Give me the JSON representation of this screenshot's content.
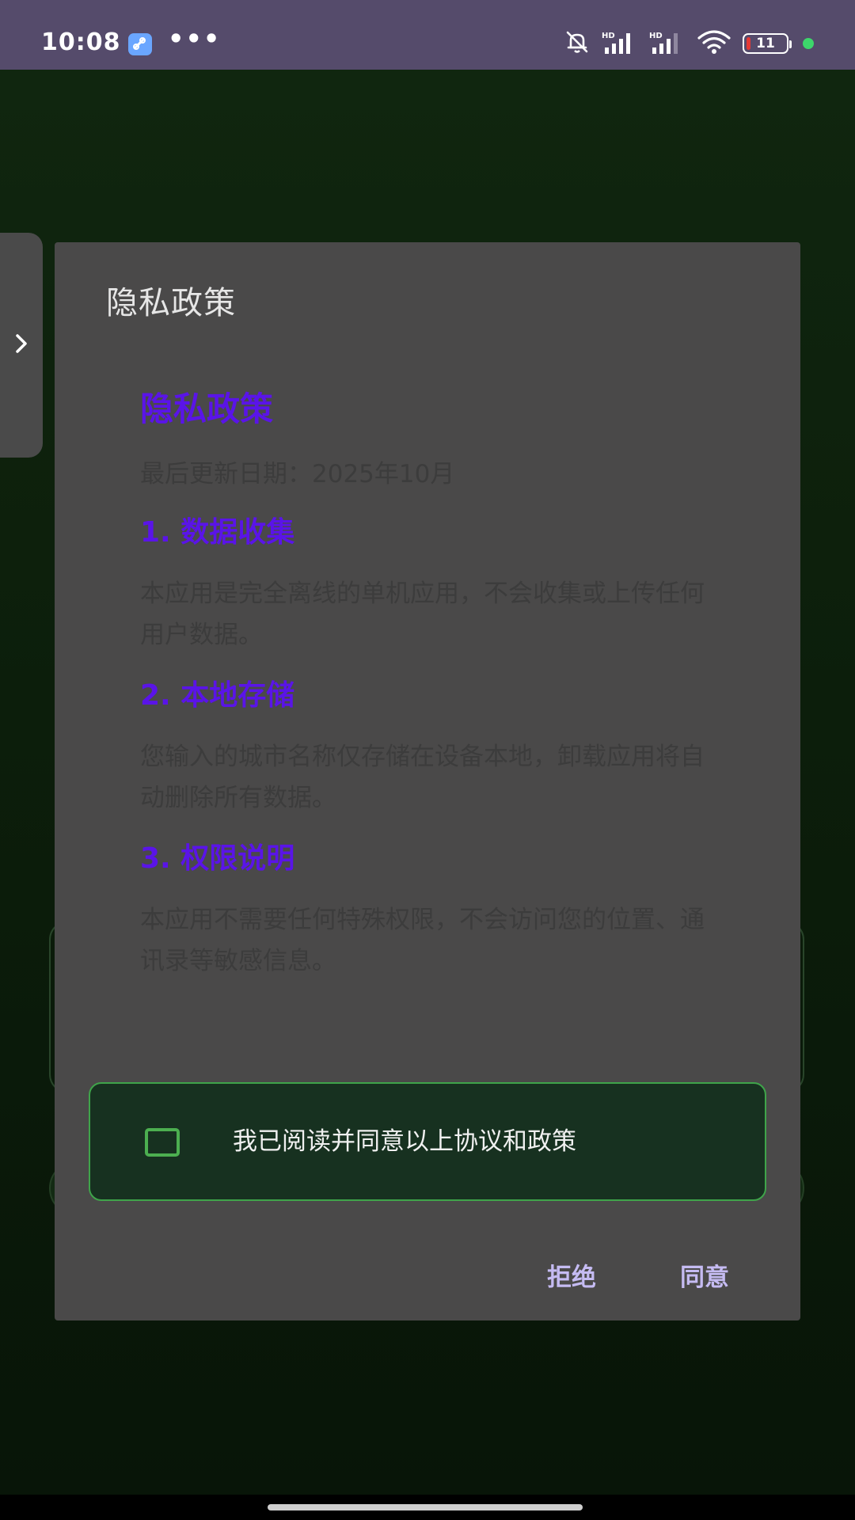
{
  "status_bar": {
    "time": "10:08",
    "more": "•••",
    "battery_level": "11",
    "battery_fraction": 0.11
  },
  "dialog": {
    "title": "隐私政策",
    "content": {
      "heading": "隐私政策",
      "updated": "最后更新日期：2025年10月",
      "sections": [
        {
          "title": "1. 数据收集",
          "body": "本应用是完全离线的单机应用，不会收集或上传任何用户数据。"
        },
        {
          "title": "2. 本地存储",
          "body": "您输入的城市名称仅存储在设备本地，卸载应用将自动删除所有数据。"
        },
        {
          "title": "3. 权限说明",
          "body": "本应用不需要任何特殊权限，不会访问您的位置、通讯录等敏感信息。"
        }
      ]
    },
    "agree_checkbox": {
      "label": "我已阅读并同意以上协议和政策",
      "checked": false
    },
    "buttons": {
      "reject": "拒绝",
      "agree": "同意"
    }
  },
  "colors": {
    "status_bar": "#554b6b",
    "dialog_bg": "#4a4949",
    "heading": "#5a14e8",
    "accent_green": "#4caf50",
    "button_text": "#c5bbf2"
  },
  "icons": {
    "app_badge": "link-icon",
    "notifications": "bell-off-icon",
    "signal": "signal-icon",
    "wifi": "wifi-icon",
    "drawer": "chevron-right-icon"
  }
}
